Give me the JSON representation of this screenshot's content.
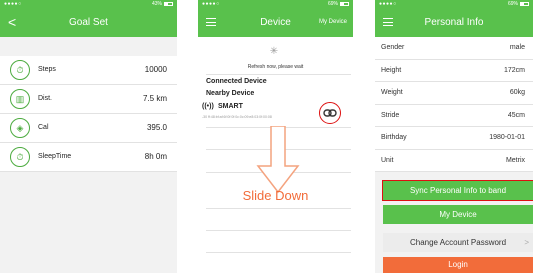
{
  "goal_screen": {
    "status_carrier": "●●●●○",
    "status_battery": "43%",
    "back_label": "<",
    "title": "Goal Set",
    "items": [
      {
        "icon": "⏱",
        "label": "Steps",
        "value": "10000"
      },
      {
        "icon": "▥",
        "label": "Dist.",
        "value": "7.5 km"
      },
      {
        "icon": "◈",
        "label": "Cal",
        "value": "395.0"
      },
      {
        "icon": "⏱",
        "label": "SleepTime",
        "value": "8h  0m"
      }
    ]
  },
  "device_screen": {
    "status_carrier": "●●●●○",
    "status_battery": "69%",
    "title": "Device",
    "right_link": "My Device",
    "spinner_glyph": "✳",
    "refresh_text": "Refresh now, please wait",
    "connected_header": "Connected Device",
    "nearby_header": "Nearby Device",
    "device": {
      "signal_icon": "((•))",
      "name": "SMART",
      "mac": "-30   ff:48:bf:af:6f:0f:0f:0c:0c:09:e8:03:0f:00:08"
    },
    "link_icon_glyph": "⊖",
    "instruction": "Slide Down"
  },
  "info_screen": {
    "status_carrier": "●●●●○",
    "status_battery": "69%",
    "title": "Personal Info",
    "rows": [
      {
        "label": "Gender",
        "value": "male"
      },
      {
        "label": "Height",
        "value": "172cm"
      },
      {
        "label": "Weight",
        "value": "60kg"
      },
      {
        "label": "Stride",
        "value": "45cm"
      },
      {
        "label": "Birthday",
        "value": "1980-01-01"
      },
      {
        "label": "Unit",
        "value": "Metrix"
      }
    ],
    "sync_button": "Sync Personal Info to band",
    "my_device_button": "My Device",
    "change_password_button": "Change Account Password",
    "change_password_chevron": ">",
    "login_button": "Login"
  },
  "colors": {
    "brand_green": "#59c14c",
    "accent_orange": "#f26c3a",
    "highlight_red": "#dd1111"
  }
}
